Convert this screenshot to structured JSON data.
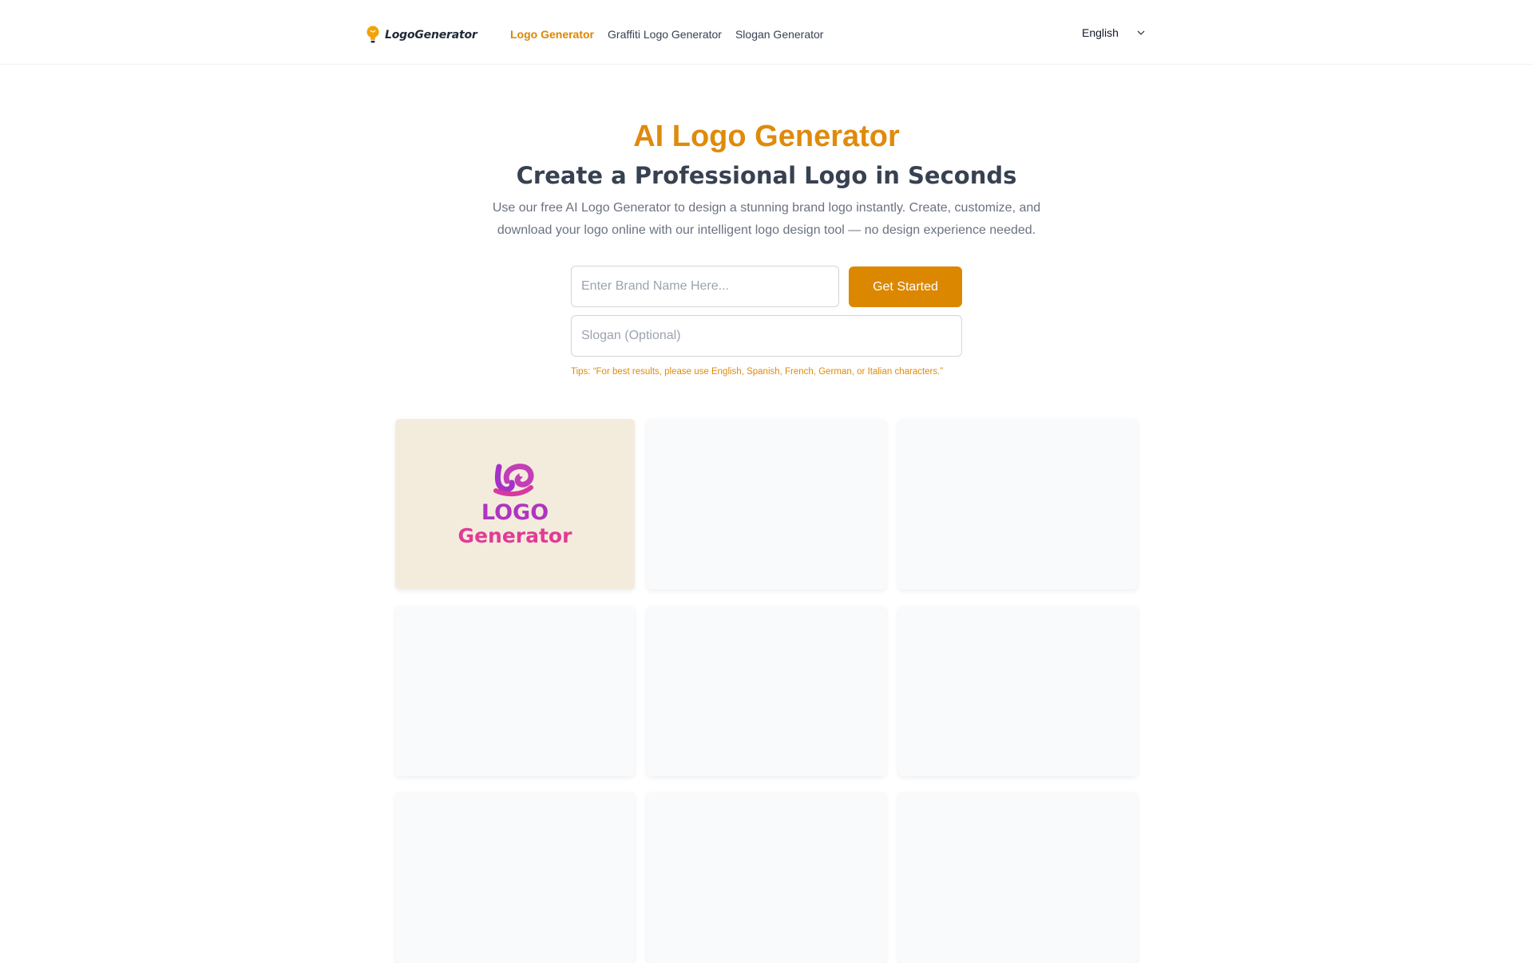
{
  "header": {
    "brand": "LogoGenerator",
    "nav": [
      {
        "label": "Logo Generator",
        "active": true
      },
      {
        "label": "Graffiti Logo Generator",
        "active": false
      },
      {
        "label": "Slogan Generator",
        "active": false
      }
    ],
    "language": "English"
  },
  "hero": {
    "title": "AI Logo Generator",
    "subtitle": "Create a Professional Logo in Seconds",
    "description": "Use our free AI Logo Generator to design a stunning brand logo instantly. Create, customize, and download your logo online with our intelligent logo design tool — no design experience needed."
  },
  "form": {
    "brand_placeholder": "Enter Brand Name Here...",
    "slogan_placeholder": "Slogan (Optional)",
    "submit_label": "Get Started",
    "tips": "Tips: “For best results, please use English, Spanish, French, German, or Italian characters.”"
  },
  "gallery": {
    "featured_logo": {
      "line1": "LOGO",
      "line2": "Generator"
    }
  },
  "colors": {
    "accent": "#dd8600",
    "featured_card_bg": "#f3ecdd",
    "logo_purple": "#9b2fbd",
    "logo_pink": "#e23d97"
  }
}
